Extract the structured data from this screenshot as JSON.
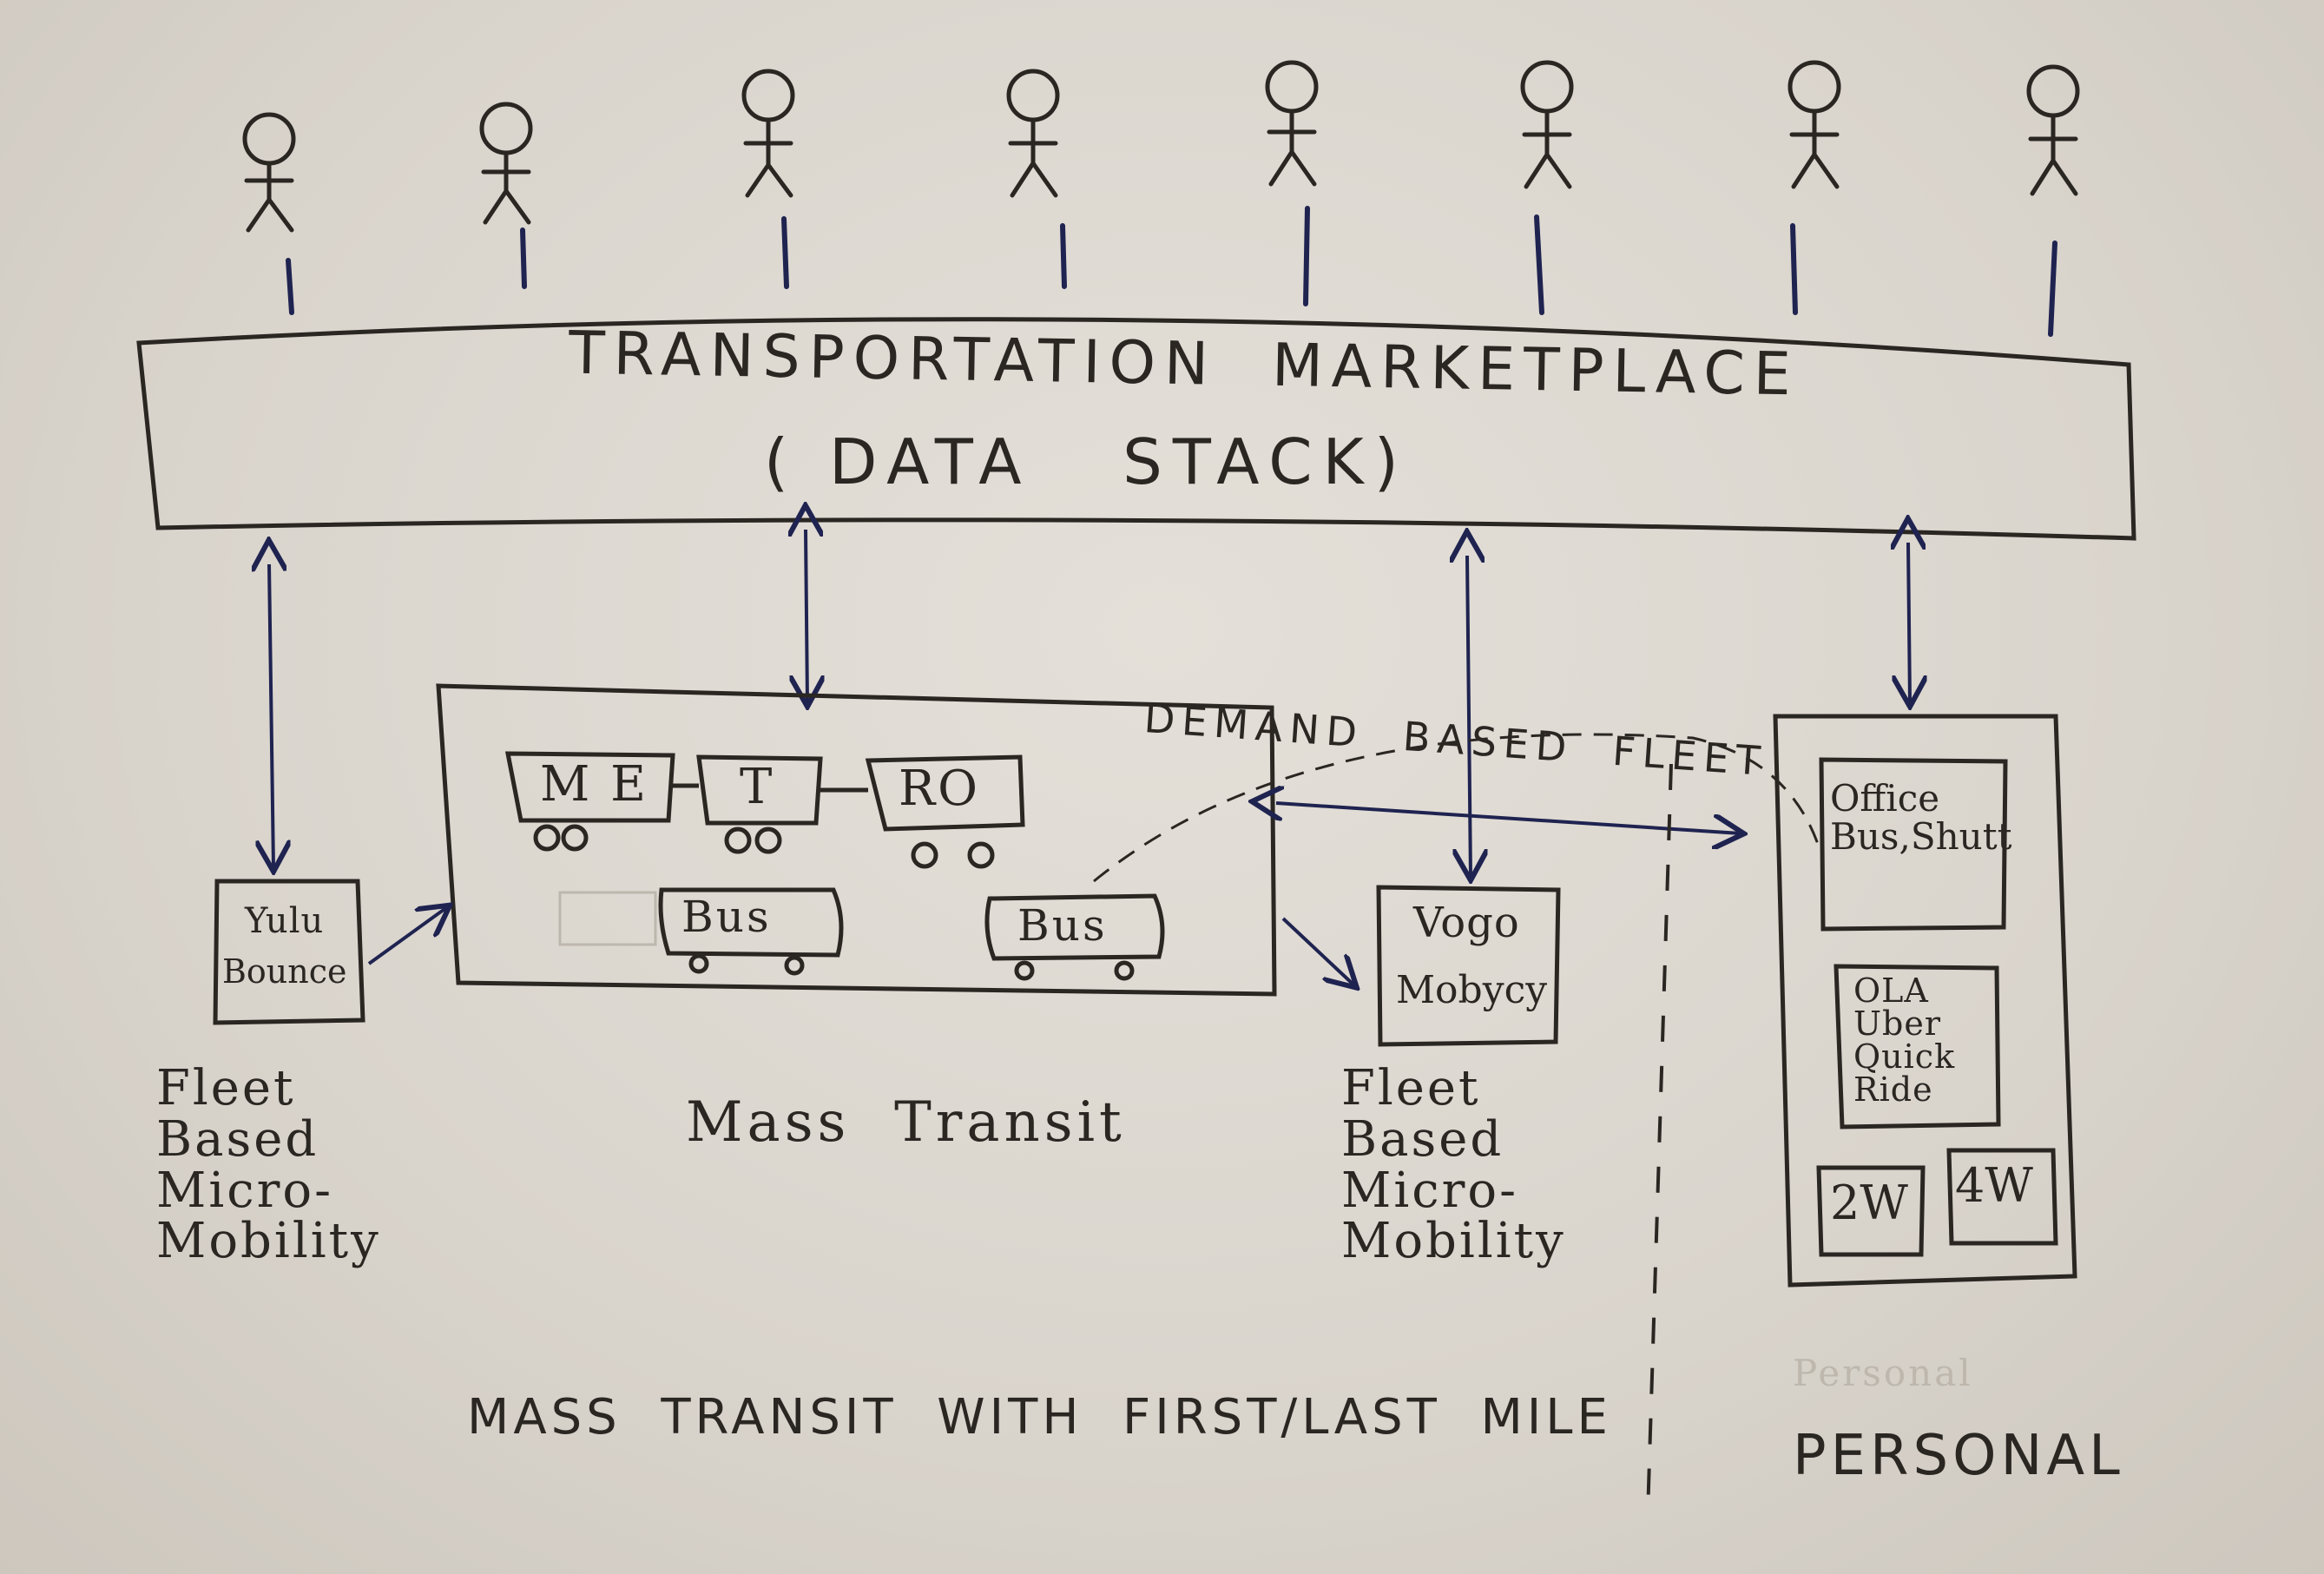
{
  "marketplace": {
    "title_line1": "TRANSPORTATION  MARKETPLACE",
    "title_line2": "( DATA   STACK)"
  },
  "metro": {
    "car1": "M E",
    "car2": "T",
    "car3": "RO"
  },
  "buses": {
    "bus1": "Bus",
    "bus2": "Bus"
  },
  "yulu_box": {
    "line1": "Yulu",
    "line2": "Bounce"
  },
  "vogo_box": {
    "line1": "Vogo",
    "line2": "Mobycy"
  },
  "personal_items": {
    "office": "Office\nBus,Shutt",
    "ola": "OLA\nUber\nQuick\nRide",
    "two_w": "2W",
    "four_w": "4W"
  },
  "demand_label": "DEMAND  BASED  FLEET",
  "captions": {
    "fleet_left": "Fleet\nBased\nMicro-\nMobility",
    "mass_transit": "Mass  Transit",
    "fleet_right": "Fleet\nBased\nMicro-\nMobility"
  },
  "bottom": {
    "mass_transit_first_last": "MASS  TRANSIT  WITH  FIRST/LAST  MILE",
    "personal": "PERSONAL",
    "personal_faint": "Personal"
  },
  "colors": {
    "ink": "#2a2622",
    "blue_ink": "#1f2350",
    "paper": "#e2ded7"
  }
}
